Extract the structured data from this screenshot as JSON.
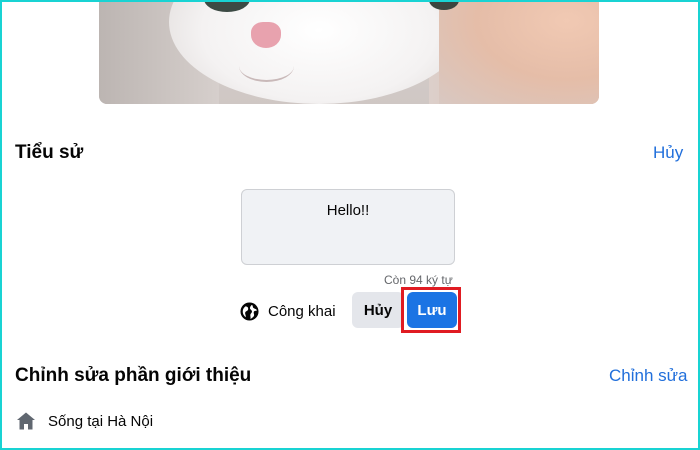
{
  "cover": {
    "alt_icon": "cat-photo"
  },
  "bio": {
    "section_title": "Tiểu sử",
    "cancel_link": "Hủy",
    "text": "Hello!!",
    "char_count": "Còn 94 ký tự",
    "privacy_label": "Công khai",
    "privacy_icon": "globe-icon",
    "cancel_button": "Hủy",
    "save_button": "Lưu"
  },
  "intro": {
    "section_title": "Chỉnh sửa phần giới thiệu",
    "edit_link": "Chỉnh sửa",
    "lives_in_prefix": "Sống tại ",
    "lives_in_city": "Hà Nội",
    "lives_in_icon": "home-icon"
  },
  "colors": {
    "accent": "#1b74e4",
    "highlight": "#e01b22",
    "frame": "#19d3d3"
  }
}
